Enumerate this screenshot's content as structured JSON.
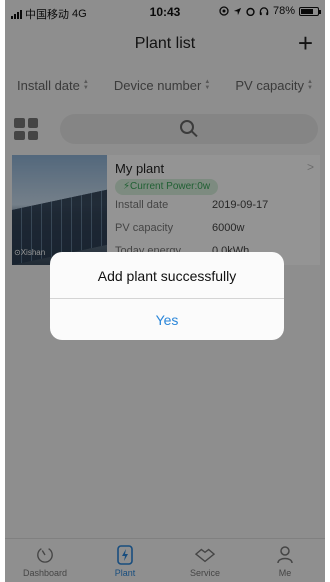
{
  "status_bar": {
    "carrier": "中国移动",
    "network": "4G",
    "time": "10:43",
    "battery": "78%",
    "battery_level": 0.78
  },
  "header": {
    "title": "Plant list",
    "add_symbol": "+"
  },
  "sort_bar": {
    "items": [
      {
        "label": "Install date"
      },
      {
        "label": "Device number"
      },
      {
        "label": "PV capacity"
      }
    ]
  },
  "plant": {
    "name": "My plant",
    "location": "Xishan",
    "current_power": "Current Power:0w",
    "rows": [
      {
        "label": "Install date",
        "value": "2019-09-17"
      },
      {
        "label": "PV capacity",
        "value": "6000w"
      },
      {
        "label": "Today energy",
        "value": "0.0kWh"
      }
    ]
  },
  "dialog": {
    "message": "Add plant successfully",
    "confirm": "Yes"
  },
  "tab_bar": {
    "items": [
      {
        "label": "Dashboard",
        "icon": "dashboard-icon"
      },
      {
        "label": "Plant",
        "icon": "plant-icon"
      },
      {
        "label": "Service",
        "icon": "service-icon"
      },
      {
        "label": "Me",
        "icon": "person-icon"
      }
    ],
    "active": "Plant"
  },
  "colors": {
    "accent": "#2a86d9",
    "power_badge_bg": "#d8f0dc",
    "power_badge_text": "#3aa55a"
  }
}
